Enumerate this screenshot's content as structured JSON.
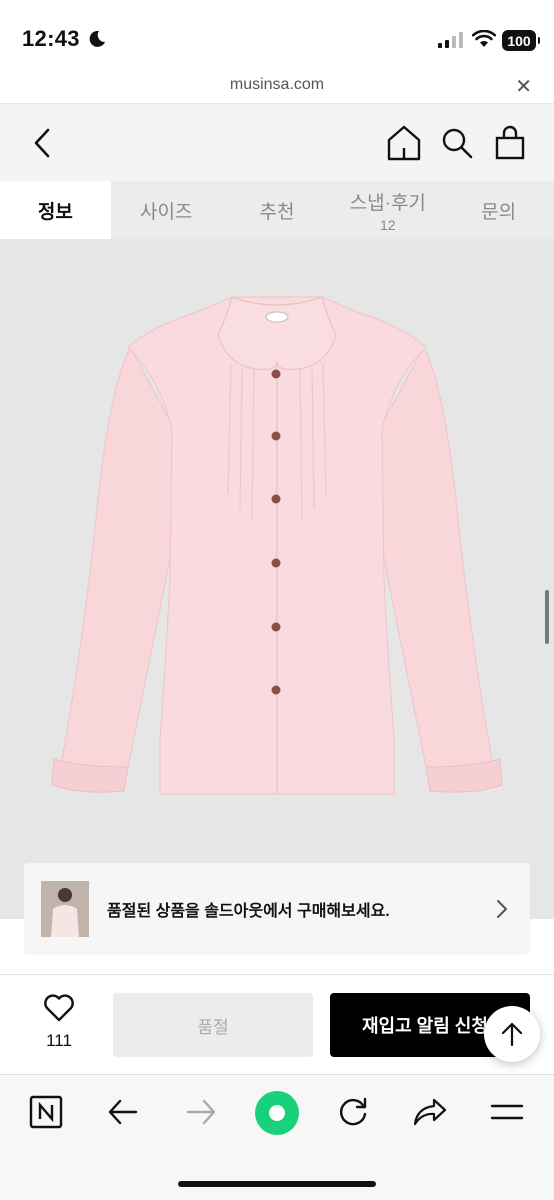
{
  "status_bar": {
    "time": "12:43",
    "battery": "100"
  },
  "browser": {
    "url": "musinsa.com",
    "close_label": "✕"
  },
  "tabs": [
    {
      "label": "정보",
      "count": ""
    },
    {
      "label": "사이즈",
      "count": ""
    },
    {
      "label": "추천",
      "count": ""
    },
    {
      "label": "스냅·후기",
      "count": "12"
    },
    {
      "label": "문의",
      "count": ""
    }
  ],
  "soldout_banner": {
    "text": "품절된 상품을 솔드아웃에서 구매해보세요."
  },
  "purchase_bar": {
    "like_count": "111",
    "soldout_label": "품절",
    "restock_label": "재입고 알림 신청"
  },
  "colors": {
    "accent": "#000000",
    "browser_green": "#19d17a",
    "shirt": "#f7d3d8"
  },
  "icons": [
    "back-icon",
    "home-icon",
    "search-icon",
    "cart-icon",
    "heart-icon",
    "arrow-up-icon",
    "chevron-right-icon"
  ]
}
